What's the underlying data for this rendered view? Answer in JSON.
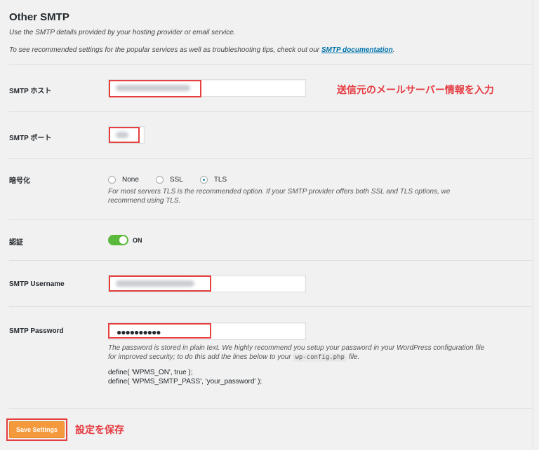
{
  "section": {
    "title": "Other SMTP",
    "desc1": "Use the SMTP details provided by your hosting provider or email service.",
    "desc2_prefix": "To see recommended settings for the popular services as well as troubleshooting tips, check out our ",
    "desc2_link": "SMTP documentation",
    "desc2_suffix": "."
  },
  "smtp_host": {
    "label": "SMTP ホスト",
    "annotation": "送信元のメールサーバー情報を入力"
  },
  "smtp_port": {
    "label": "SMTP ポート"
  },
  "encryption": {
    "label": "暗号化",
    "options": [
      "None",
      "SSL",
      "TLS"
    ],
    "selected": "TLS",
    "help_line1": "For most servers TLS is the recommended option. If your SMTP provider offers both SSL and TLS options, we",
    "help_line2": "recommend using TLS."
  },
  "auth": {
    "label": "認証",
    "toggle_state": "ON"
  },
  "smtp_username": {
    "label": "SMTP Username"
  },
  "smtp_password": {
    "label": "SMTP Password",
    "masked_value": "●●●●●●●●●●",
    "help_line1": "The password is stored in plain text. We highly recommend you setup your password in your WordPress configuration file",
    "help_line2_prefix": "for improved security; to do this add the lines below to your ",
    "help_line2_code": "wp-config.php",
    "help_line2_suffix": " file.",
    "define1": "define( 'WPMS_ON', true );",
    "define2": "define( 'WPMS_SMTP_PASS', 'your_password' );"
  },
  "save": {
    "label": "Save Settings",
    "annotation": "設定を保存"
  },
  "colors": {
    "accent_orange": "#f59a3c",
    "annotation_red": "#e5393f",
    "toggle_green": "#5ab83a",
    "link_blue": "#0073aa"
  }
}
